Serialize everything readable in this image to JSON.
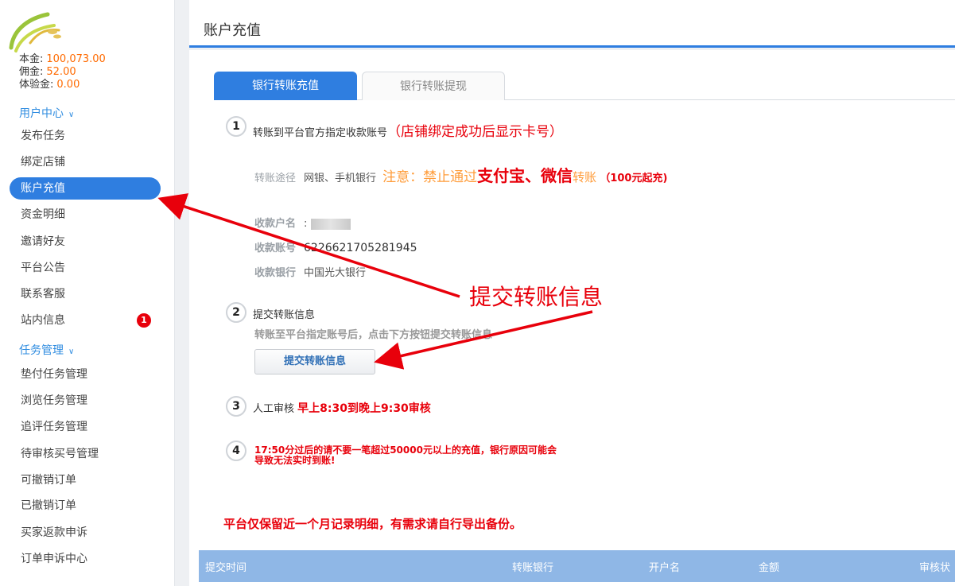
{
  "page": {
    "title": "账户充值"
  },
  "account": {
    "principal_label": "本金:",
    "principal_value": "100,073.00",
    "commission_label": "佣金:",
    "commission_value": "52.00",
    "trial_label": "体验金:",
    "trial_value": "0.00"
  },
  "sidebar": {
    "user_center": "用户中心",
    "user_items": [
      "发布任务",
      "绑定店铺",
      "账户充值",
      "资金明细",
      "邀请好友",
      "平台公告",
      "联系客服",
      "站内信息"
    ],
    "inbox_badge": "1",
    "task_mgmt": "任务管理",
    "task_items": [
      "垫付任务管理",
      "浏览任务管理",
      "追评任务管理",
      "待审核买号管理",
      "可撤销订单",
      "已撤销订单",
      "买家返款申诉",
      "订单申诉中心"
    ]
  },
  "tabs": {
    "active": "银行转账充值",
    "inactive": "银行转账提现"
  },
  "steps": {
    "s1_num": "1",
    "s1_label": "转账到平台官方指定收款账号",
    "s1_note": "（店铺绑定成功后显示卡号）",
    "route_label": "转账途径",
    "route_value": "网银、手机银行",
    "warn_prefix": "注意：禁止通过",
    "warn_strong": "支付宝、微信",
    "warn_suffix": "转账",
    "min_note": "（100元起充)",
    "payee_label": "收款户名",
    "payee_value": ":",
    "account_label": "收款账号",
    "account_value": "6226621705281945",
    "bank_label": "收款银行",
    "bank_value": "中国光大银行",
    "s2_num": "2",
    "s2_label": "提交转账信息",
    "s2_hint": "转账至平台指定账号后，点击下方按钮提交转账信息",
    "submit_btn": "提交转账信息",
    "s3_num": "3",
    "s3_label": "人工审核",
    "s3_hours": "早上8:30到晚上9:30审核",
    "s4_num": "4",
    "s4_line1": "17:50分过后的请不要一笔超过50000元以上的充值，银行原因可能会",
    "s4_line2": "导致无法实时到账!"
  },
  "notice": "平台仅保留近一个月记录明细，有需求请自行导出备份。",
  "table": {
    "headers": [
      "提交时间",
      "转账银行",
      "开户名",
      "金额",
      "审核状"
    ]
  },
  "annotation": {
    "text": "提交转账信息",
    "color": "#e8000b"
  },
  "colors": {
    "accent": "#2f7ee0",
    "warning_red": "#e8000b",
    "orange": "#ff9c3a"
  }
}
